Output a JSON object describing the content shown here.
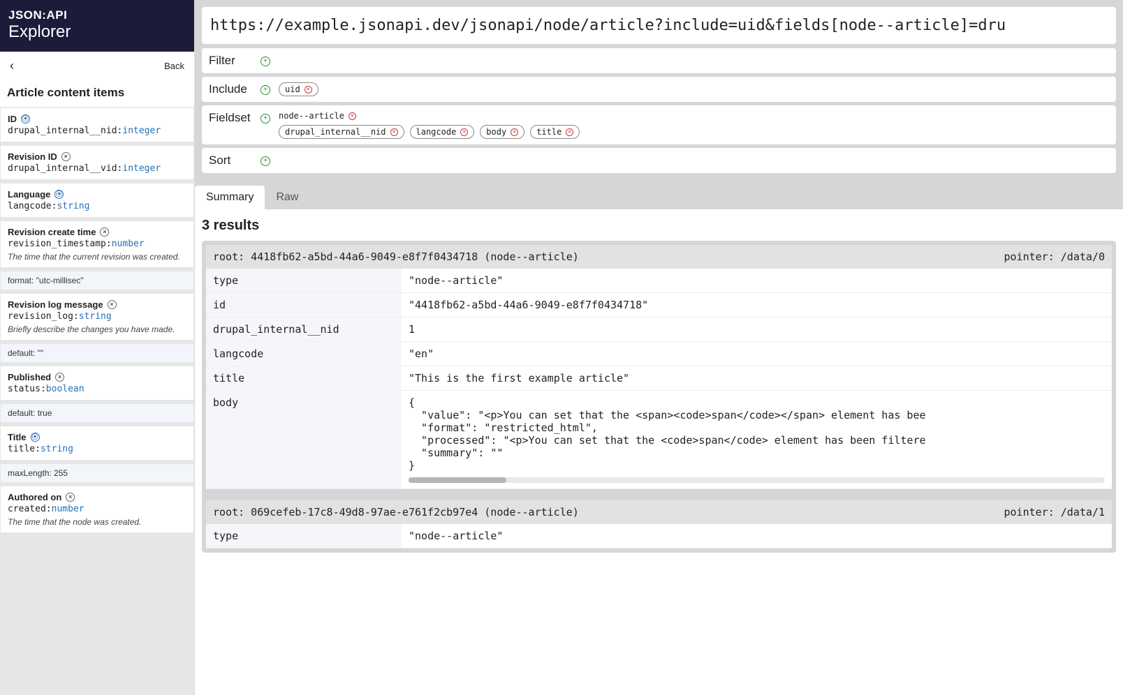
{
  "brand": {
    "line1": "JSON:API",
    "line2": "Explorer"
  },
  "back": {
    "label": "Back"
  },
  "sidebar": {
    "title": "Article content items",
    "attrs": [
      {
        "label": "ID",
        "machine": "drupal_internal__nid",
        "type": "integer",
        "toggle": "on"
      },
      {
        "label": "Revision ID",
        "machine": "drupal_internal__vid",
        "type": "integer",
        "toggle": "off"
      },
      {
        "label": "Language",
        "machine": "langcode",
        "type": "string",
        "toggle": "on"
      },
      {
        "label": "Revision create time",
        "machine": "revision_timestamp",
        "type": "number",
        "toggle": "off",
        "desc": "The time that the current revision was created.",
        "sub": "format: \"utc-millisec\""
      },
      {
        "label": "Revision log message",
        "machine": "revision_log",
        "type": "string",
        "toggle": "off",
        "desc": "Briefly describe the changes you have made.",
        "sub": "default: \"\""
      },
      {
        "label": "Published",
        "machine": "status",
        "type": "boolean",
        "toggle": "off",
        "sub": "default: true"
      },
      {
        "label": "Title",
        "machine": "title",
        "type": "string",
        "toggle": "on",
        "sub": "maxLength: 255"
      },
      {
        "label": "Authored on",
        "machine": "created",
        "type": "number",
        "toggle": "off",
        "desc": "The time that the node was created."
      }
    ]
  },
  "url": "https://example.jsonapi.dev/jsonapi/node/article?include=uid&fields[node--article]=dru",
  "params": {
    "filter_label": "Filter",
    "include_label": "Include",
    "include_chips": [
      "uid"
    ],
    "fieldset_label": "Fieldset",
    "fieldset_group": "node--article",
    "fieldset_chips": [
      "drupal_internal__nid",
      "langcode",
      "body",
      "title"
    ],
    "sort_label": "Sort"
  },
  "tabs": {
    "summary": "Summary",
    "raw": "Raw"
  },
  "results_header": "3 results",
  "results": [
    {
      "root": "root: 4418fb62-a5bd-44a6-9049-e8f7f0434718 (node--article)",
      "pointer": "pointer: /data/0",
      "rows": [
        {
          "k": "type",
          "v": "\"node--article\""
        },
        {
          "k": "id",
          "v": "\"4418fb62-a5bd-44a6-9049-e8f7f0434718\""
        },
        {
          "k": "drupal_internal__nid",
          "v": "1"
        },
        {
          "k": "langcode",
          "v": "\"en\""
        },
        {
          "k": "title",
          "v": "\"This is the first example article\""
        },
        {
          "k": "body",
          "v": "{\n  \"value\": \"<p>You can set that the <span><code>span</code></span> element has bee\n  \"format\": \"restricted_html\",\n  \"processed\": \"<p>You can set that the <code>span</code> element has been filtere\n  \"summary\": \"\"\n}",
          "body": true
        }
      ]
    },
    {
      "root": "root: 069cefeb-17c8-49d8-97ae-e761f2cb97e4 (node--article)",
      "pointer": "pointer: /data/1",
      "rows": [
        {
          "k": "type",
          "v": "\"node--article\""
        }
      ]
    }
  ]
}
